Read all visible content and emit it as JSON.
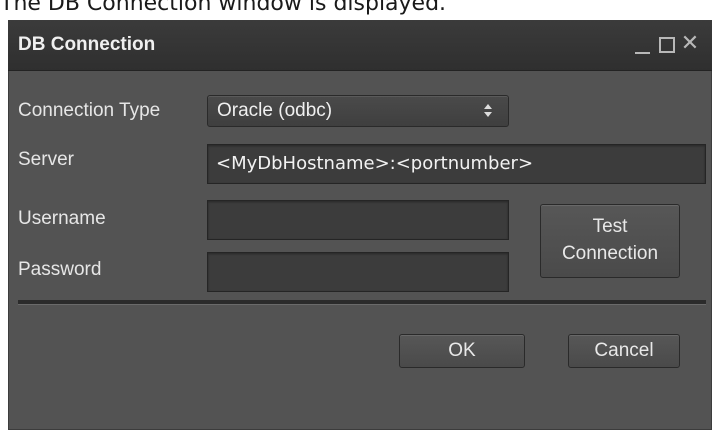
{
  "caption": "The DB Connection window is displayed.",
  "window": {
    "title": "DB Connection",
    "controls": {
      "minimize": "minimize-icon",
      "maximize": "maximize-icon",
      "close": "close-icon"
    }
  },
  "form": {
    "connection_type_label": "Connection Type",
    "connection_type_value": "Oracle (odbc)",
    "server_label": "Server",
    "server_value": "<MyDbHostname>:<portnumber>",
    "username_label": "Username",
    "username_value": "",
    "password_label": "Password",
    "password_value": ""
  },
  "buttons": {
    "test_connection_line1": "Test",
    "test_connection_line2": "Connection",
    "ok": "OK",
    "cancel": "Cancel"
  },
  "colors": {
    "window_bg": "#535353",
    "titlebar_bg": "#333333",
    "field_bg": "#3c3c3c",
    "text": "#e6e6e6"
  }
}
